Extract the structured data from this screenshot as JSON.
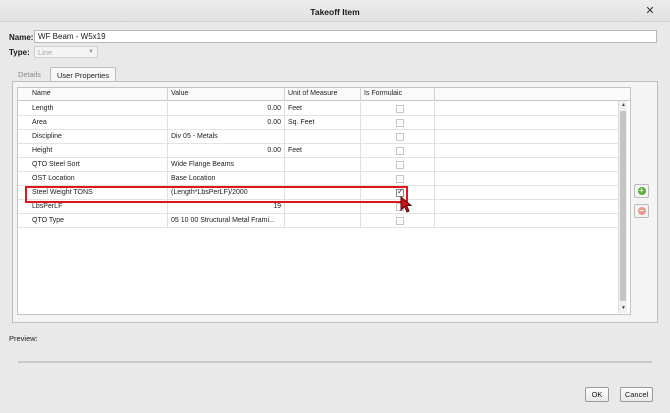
{
  "window": {
    "title": "Takeoff Item",
    "close_glyph": "✕"
  },
  "form": {
    "name_label": "Name:",
    "name_value": "WF Beam - W5x19",
    "type_label": "Type:",
    "type_value": "Line"
  },
  "tabs": [
    {
      "label": "Details",
      "active": false
    },
    {
      "label": "User Properties",
      "active": true
    }
  ],
  "grid": {
    "columns": [
      "Name",
      "Value",
      "Unit of Measure",
      "Is Formulaic"
    ],
    "rows": [
      {
        "name": "Length",
        "value": "0.00",
        "unit": "Feet",
        "formulaic": false
      },
      {
        "name": "Area",
        "value": "0.00",
        "unit": "Sq. Feet",
        "formulaic": false
      },
      {
        "name": "Discipline",
        "value": "Div 05 - Metals",
        "unit": "",
        "formulaic": false
      },
      {
        "name": "Height",
        "value": "0.00",
        "unit": "Feet",
        "formulaic": false
      },
      {
        "name": "QTO Steel Sort",
        "value": "Wide Flange Beams",
        "unit": "",
        "formulaic": false
      },
      {
        "name": "OST Location",
        "value": "Base Location",
        "unit": "",
        "formulaic": false
      },
      {
        "name": "Steel Weight TONS",
        "value": "(Length*LbsPerLF)/2000",
        "unit": "",
        "formulaic": true
      },
      {
        "name": "LbsPerLF",
        "value": "19",
        "unit": "",
        "formulaic": false
      },
      {
        "name": "QTO Type",
        "value": "05 10 00 Structural Metal Frami...",
        "unit": "",
        "formulaic": false
      }
    ]
  },
  "side_buttons": {
    "add_icon": "plus-circle-icon",
    "remove_icon": "minus-circle-icon"
  },
  "preview": {
    "label": "Preview:"
  },
  "footer": {
    "ok_label": "OK",
    "cancel_label": "Cancel"
  },
  "colors": {
    "highlight": "#e0161f",
    "add_green": "#5aab3a",
    "remove_red": "#e59a8e"
  }
}
